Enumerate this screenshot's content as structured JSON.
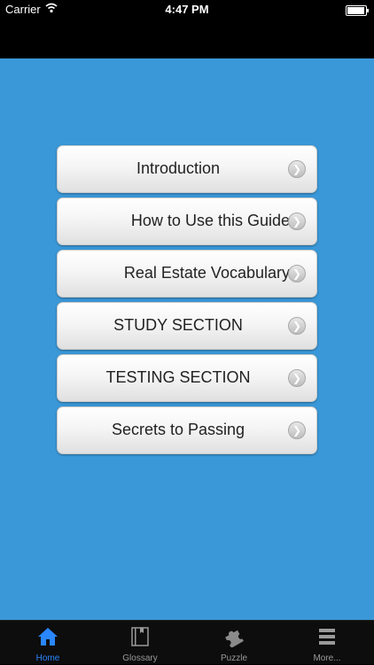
{
  "status_bar": {
    "carrier": "Carrier",
    "time": "4:47 PM",
    "battery_level": 0.95
  },
  "menu": {
    "items": [
      {
        "label": "Introduction",
        "align": "center"
      },
      {
        "label": "How to Use this Guide",
        "align": "right"
      },
      {
        "label": "Real Estate Vocabulary",
        "align": "right"
      },
      {
        "label": "STUDY SECTION",
        "align": "center"
      },
      {
        "label": "TESTING SECTION",
        "align": "center"
      },
      {
        "label": "Secrets to Passing",
        "align": "center"
      }
    ],
    "chevron_glyph": "❯"
  },
  "tab_bar": {
    "tabs": [
      {
        "label": "Home",
        "icon": "home-icon",
        "active": true
      },
      {
        "label": "Glossary",
        "icon": "book-icon",
        "active": false
      },
      {
        "label": "Puzzle",
        "icon": "puzzle-icon",
        "active": false
      },
      {
        "label": "More...",
        "icon": "more-icon",
        "active": false
      }
    ]
  },
  "colors": {
    "background": "#3a98d8",
    "accent": "#2a86ff",
    "bar": "#000000"
  }
}
